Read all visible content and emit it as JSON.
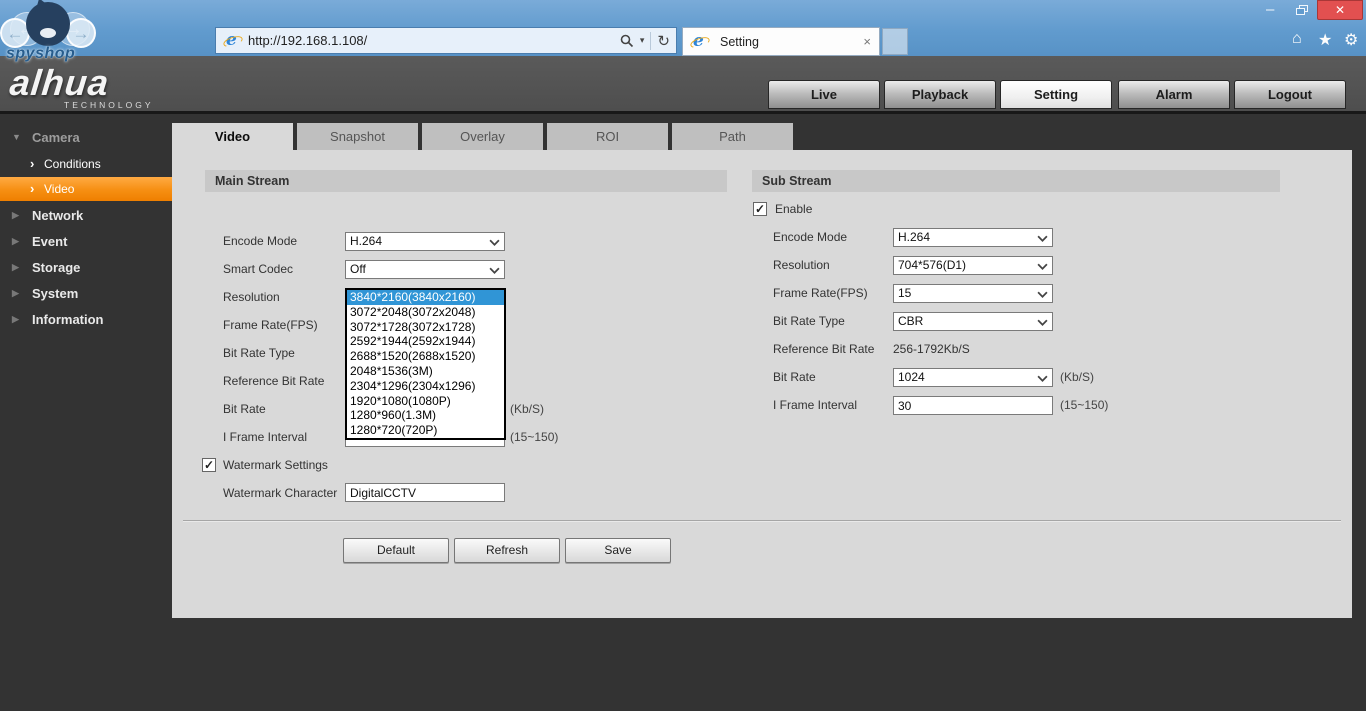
{
  "browser": {
    "url": "http://192.168.1.108/",
    "tab_title": "Setting",
    "watermark_text": "spyshop"
  },
  "icons": {
    "back_glyph": "←",
    "forward_glyph": "→",
    "caret_glyph": "▾",
    "refresh_glyph": "↻",
    "minimize_glyph": "–",
    "close_glyph": "✕",
    "tab_close_glyph": "×",
    "home_glyph": "⌂",
    "star_glyph": "★",
    "gear_glyph": "⚙",
    "ie_glyph": "e",
    "check_glyph": "✓",
    "tri_down_glyph": "▼",
    "tri_right_glyph": "▶",
    "sub_arrow_glyph": "›"
  },
  "header": {
    "logo_text": "alhua",
    "logo_sub": "TECHNOLOGY",
    "nav": [
      "Live",
      "Playback",
      "Setting",
      "Alarm",
      "Logout"
    ]
  },
  "sidebar": {
    "items": [
      {
        "label": "Camera"
      },
      {
        "label": "Conditions"
      },
      {
        "label": "Video"
      },
      {
        "label": "Network"
      },
      {
        "label": "Event"
      },
      {
        "label": "Storage"
      },
      {
        "label": "System"
      },
      {
        "label": "Information"
      }
    ]
  },
  "tabs": [
    "Video",
    "Snapshot",
    "Overlay",
    "ROI",
    "Path"
  ],
  "main_stream": {
    "title": "Main Stream",
    "encode_mode": {
      "label": "Encode Mode",
      "value": "H.264"
    },
    "smart_codec": {
      "label": "Smart Codec",
      "value": "Off"
    },
    "resolution": {
      "label": "Resolution"
    },
    "frame_rate": {
      "label": "Frame Rate(FPS)"
    },
    "bit_rate_type": {
      "label": "Bit Rate Type"
    },
    "reference_bit_rate": {
      "label": "Reference Bit Rate"
    },
    "bit_rate": {
      "label": "Bit Rate",
      "unit": "(Kb/S)"
    },
    "i_frame_interval": {
      "label": "I Frame Interval",
      "range": "(15~150)"
    },
    "resolution_dropdown": {
      "selected_index": 0,
      "options": [
        "3840*2160(3840x2160)",
        "3072*2048(3072x2048)",
        "3072*1728(3072x1728)",
        "2592*1944(2592x1944)",
        "2688*1520(2688x1520)",
        "2048*1536(3M)",
        "2304*1296(2304x1296)",
        "1920*1080(1080P)",
        "1280*960(1.3M)",
        "1280*720(720P)"
      ]
    },
    "watermark_settings_label": "Watermark Settings",
    "watermark_character": {
      "label": "Watermark Character",
      "value": "DigitalCCTV"
    }
  },
  "sub_stream": {
    "title": "Sub Stream",
    "enable_label": "Enable",
    "encode_mode": {
      "label": "Encode Mode",
      "value": "H.264"
    },
    "resolution": {
      "label": "Resolution",
      "value": "704*576(D1)"
    },
    "frame_rate": {
      "label": "Frame Rate(FPS)",
      "value": "15"
    },
    "bit_rate_type": {
      "label": "Bit Rate Type",
      "value": "CBR"
    },
    "reference_bit_rate": {
      "label": "Reference Bit Rate",
      "value": "256-1792Kb/S"
    },
    "bit_rate": {
      "label": "Bit Rate",
      "value": "1024",
      "unit": "(Kb/S)"
    },
    "i_frame_interval": {
      "label": "I Frame Interval",
      "value": "30",
      "range": "(15~150)"
    }
  },
  "actions": {
    "default": "Default",
    "refresh": "Refresh",
    "save": "Save"
  },
  "colors": {
    "accent_orange": "#f68f12",
    "selection_blue": "#3095d6",
    "browser_blue": "#619bce",
    "panel_gray": "#d9d9d9",
    "page_dark": "#333333"
  }
}
